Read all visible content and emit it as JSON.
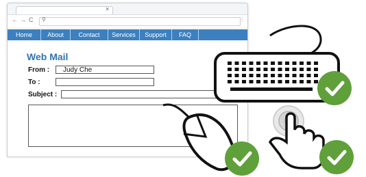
{
  "browser": {
    "nav_back": "←",
    "nav_forward": "→",
    "nav_reload": "C",
    "search_glyph": "⚲",
    "tab_close": "✕",
    "menu_dots": "⋮"
  },
  "nav": {
    "items": [
      "Home",
      "About",
      "Contact",
      "Services",
      "Support",
      "FAQ"
    ]
  },
  "form": {
    "title": "Web Mail",
    "from_label": "From :",
    "from_value": "Judy Che",
    "to_label": "To :",
    "to_value": "",
    "subject_label": "Subject :",
    "subject_value": "",
    "body_value": ""
  },
  "colors": {
    "accent": "#3c80bf",
    "title": "#2f73b4",
    "check_badge": "#5fa03a"
  },
  "icons": [
    "keyboard-icon",
    "mouse-icon",
    "touch-hand-icon",
    "checkmark-icon"
  ]
}
